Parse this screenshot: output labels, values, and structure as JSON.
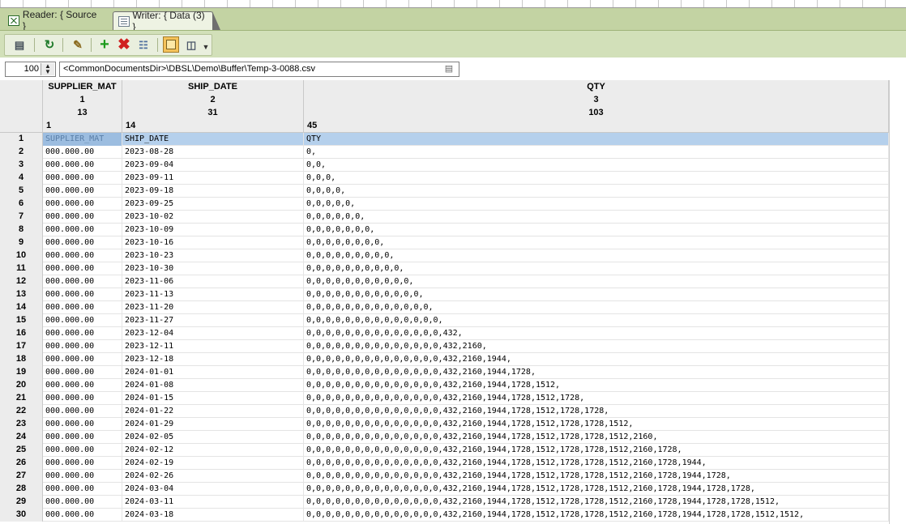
{
  "tabs": [
    {
      "label": "Reader: { Source }",
      "icon": "reader-icon",
      "active": false
    },
    {
      "label": "Writer: { Data (3) }",
      "icon": "writer-icon",
      "active": true
    }
  ],
  "toolbar": {
    "buttons": [
      "properties-icon",
      "refresh-icon",
      "edit-icon",
      "add-icon",
      "delete-icon",
      "tree-icon",
      "grid-view-icon",
      "text-view-icon",
      "more-icon"
    ]
  },
  "pathbar": {
    "row_limit": "100",
    "file_path": "<CommonDocumentsDir>\\DBSL\\Demo\\Buffer\\Temp-3-0088.csv"
  },
  "columns": {
    "names": [
      "SUPPLIER_MAT",
      "SHIP_DATE",
      "QTY"
    ],
    "index": [
      "1",
      "2",
      "3"
    ],
    "width": [
      "13",
      "31",
      "103"
    ],
    "position": [
      "1",
      "14",
      "45"
    ]
  },
  "rows": [
    {
      "n": "1",
      "mat": "SUPPLIER_MAT",
      "date": "SHIP_DATE",
      "qty": "QTY"
    },
    {
      "n": "2",
      "mat": "000.000.00",
      "date": "2023-08-28",
      "qty": "0,"
    },
    {
      "n": "3",
      "mat": "000.000.00",
      "date": "2023-09-04",
      "qty": "0,0,"
    },
    {
      "n": "4",
      "mat": "000.000.00",
      "date": "2023-09-11",
      "qty": "0,0,0,"
    },
    {
      "n": "5",
      "mat": "000.000.00",
      "date": "2023-09-18",
      "qty": "0,0,0,0,"
    },
    {
      "n": "6",
      "mat": "000.000.00",
      "date": "2023-09-25",
      "qty": "0,0,0,0,0,"
    },
    {
      "n": "7",
      "mat": "000.000.00",
      "date": "2023-10-02",
      "qty": "0,0,0,0,0,0,"
    },
    {
      "n": "8",
      "mat": "000.000.00",
      "date": "2023-10-09",
      "qty": "0,0,0,0,0,0,0,"
    },
    {
      "n": "9",
      "mat": "000.000.00",
      "date": "2023-10-16",
      "qty": "0,0,0,0,0,0,0,0,"
    },
    {
      "n": "10",
      "mat": "000.000.00",
      "date": "2023-10-23",
      "qty": "0,0,0,0,0,0,0,0,0,"
    },
    {
      "n": "11",
      "mat": "000.000.00",
      "date": "2023-10-30",
      "qty": "0,0,0,0,0,0,0,0,0,0,"
    },
    {
      "n": "12",
      "mat": "000.000.00",
      "date": "2023-11-06",
      "qty": "0,0,0,0,0,0,0,0,0,0,0,"
    },
    {
      "n": "13",
      "mat": "000.000.00",
      "date": "2023-11-13",
      "qty": "0,0,0,0,0,0,0,0,0,0,0,0,"
    },
    {
      "n": "14",
      "mat": "000.000.00",
      "date": "2023-11-20",
      "qty": "0,0,0,0,0,0,0,0,0,0,0,0,0,"
    },
    {
      "n": "15",
      "mat": "000.000.00",
      "date": "2023-11-27",
      "qty": "0,0,0,0,0,0,0,0,0,0,0,0,0,0,"
    },
    {
      "n": "16",
      "mat": "000.000.00",
      "date": "2023-12-04",
      "qty": "0,0,0,0,0,0,0,0,0,0,0,0,0,0,432,"
    },
    {
      "n": "17",
      "mat": "000.000.00",
      "date": "2023-12-11",
      "qty": "0,0,0,0,0,0,0,0,0,0,0,0,0,0,432,2160,"
    },
    {
      "n": "18",
      "mat": "000.000.00",
      "date": "2023-12-18",
      "qty": "0,0,0,0,0,0,0,0,0,0,0,0,0,0,432,2160,1944,"
    },
    {
      "n": "19",
      "mat": "000.000.00",
      "date": "2024-01-01",
      "qty": "0,0,0,0,0,0,0,0,0,0,0,0,0,0,432,2160,1944,1728,"
    },
    {
      "n": "20",
      "mat": "000.000.00",
      "date": "2024-01-08",
      "qty": "0,0,0,0,0,0,0,0,0,0,0,0,0,0,432,2160,1944,1728,1512,"
    },
    {
      "n": "21",
      "mat": "000.000.00",
      "date": "2024-01-15",
      "qty": "0,0,0,0,0,0,0,0,0,0,0,0,0,0,432,2160,1944,1728,1512,1728,"
    },
    {
      "n": "22",
      "mat": "000.000.00",
      "date": "2024-01-22",
      "qty": "0,0,0,0,0,0,0,0,0,0,0,0,0,0,432,2160,1944,1728,1512,1728,1728,"
    },
    {
      "n": "23",
      "mat": "000.000.00",
      "date": "2024-01-29",
      "qty": "0,0,0,0,0,0,0,0,0,0,0,0,0,0,432,2160,1944,1728,1512,1728,1728,1512,"
    },
    {
      "n": "24",
      "mat": "000.000.00",
      "date": "2024-02-05",
      "qty": "0,0,0,0,0,0,0,0,0,0,0,0,0,0,432,2160,1944,1728,1512,1728,1728,1512,2160,"
    },
    {
      "n": "25",
      "mat": "000.000.00",
      "date": "2024-02-12",
      "qty": "0,0,0,0,0,0,0,0,0,0,0,0,0,0,432,2160,1944,1728,1512,1728,1728,1512,2160,1728,"
    },
    {
      "n": "26",
      "mat": "000.000.00",
      "date": "2024-02-19",
      "qty": "0,0,0,0,0,0,0,0,0,0,0,0,0,0,432,2160,1944,1728,1512,1728,1728,1512,2160,1728,1944,"
    },
    {
      "n": "27",
      "mat": "000.000.00",
      "date": "2024-02-26",
      "qty": "0,0,0,0,0,0,0,0,0,0,0,0,0,0,432,2160,1944,1728,1512,1728,1728,1512,2160,1728,1944,1728,"
    },
    {
      "n": "28",
      "mat": "000.000.00",
      "date": "2024-03-04",
      "qty": "0,0,0,0,0,0,0,0,0,0,0,0,0,0,432,2160,1944,1728,1512,1728,1728,1512,2160,1728,1944,1728,1728,"
    },
    {
      "n": "29",
      "mat": "000.000.00",
      "date": "2024-03-11",
      "qty": "0,0,0,0,0,0,0,0,0,0,0,0,0,0,432,2160,1944,1728,1512,1728,1728,1512,2160,1728,1944,1728,1728,1512,"
    },
    {
      "n": "30",
      "mat": "000.000.00",
      "date": "2024-03-18",
      "qty": "0,0,0,0,0,0,0,0,0,0,0,0,0,0,432,2160,1944,1728,1512,1728,1728,1512,2160,1728,1944,1728,1728,1512,1512,"
    }
  ],
  "colors": {
    "tabbar": "#c3d3a3",
    "toolbar": "#d2e0b9",
    "selection": "#b5d0ec"
  }
}
